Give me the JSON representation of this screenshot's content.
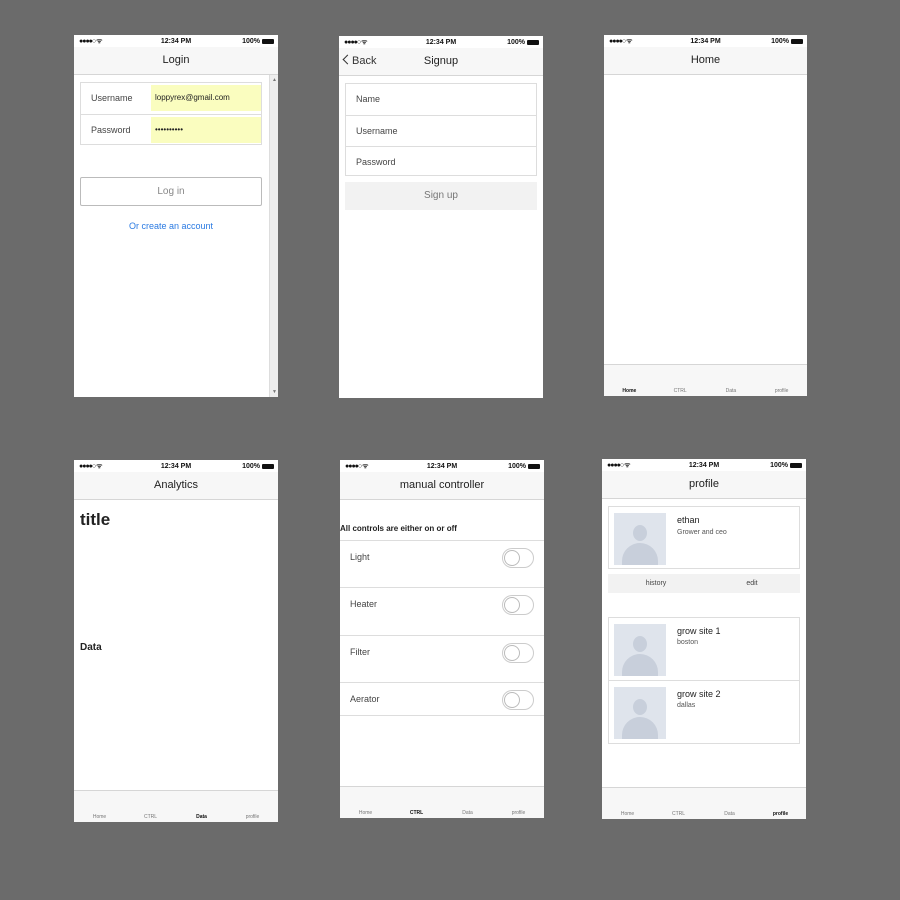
{
  "status": {
    "time": "12:34 PM",
    "battery": "100%",
    "signal": "●●●●○ ᯤ"
  },
  "tabs": [
    {
      "label": "Home",
      "icon": "flask-icon"
    },
    {
      "label": "CTRL",
      "icon": "toggles-icon"
    },
    {
      "label": "Data",
      "icon": "bar-chart-icon"
    },
    {
      "label": "profile",
      "icon": "users-icon"
    }
  ],
  "login": {
    "title": "Login",
    "username_label": "Username",
    "username_value": "loppyrex@gmail.com",
    "password_label": "Password",
    "password_value": "••••••••••",
    "login_button": "Log in",
    "create_link": "Or create an account"
  },
  "signup": {
    "title": "Signup",
    "back": "Back",
    "fields": [
      "Name",
      "Username",
      "Password"
    ],
    "button": "Sign up"
  },
  "home": {
    "title": "Home"
  },
  "analytics": {
    "title": "Analytics",
    "heading": "title",
    "data_label": "Data"
  },
  "manual": {
    "title": "manual controller",
    "note": "All controls are either on or off",
    "controls": [
      "Light",
      "Heater",
      "Filter",
      "Aerator"
    ]
  },
  "profile": {
    "title": "profile",
    "user": {
      "name": "ethan",
      "role": "Grower and ceo"
    },
    "segments": [
      "history",
      "edit"
    ],
    "sites": [
      {
        "name": "grow site 1",
        "location": "boston"
      },
      {
        "name": "grow site 2",
        "location": "dallas"
      }
    ]
  }
}
